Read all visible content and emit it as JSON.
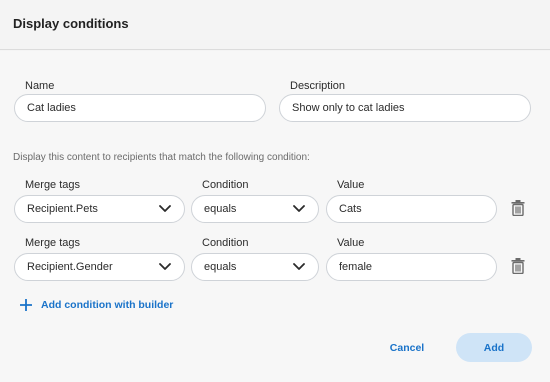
{
  "dialog": {
    "title": "Display conditions"
  },
  "form": {
    "name_label": "Name",
    "name_value": "Cat ladies",
    "description_label": "Description",
    "description_value": "Show only to cat ladies"
  },
  "helper_text": "Display this content to recipients that match the following condition:",
  "conditions": [
    {
      "merge_label": "Merge tags",
      "merge_value": "Recipient.Pets",
      "condition_label": "Condition",
      "condition_value": "equals",
      "value_label": "Value",
      "value_value": "Cats"
    },
    {
      "merge_label": "Merge tags",
      "merge_value": "Recipient.Gender",
      "condition_label": "Condition",
      "condition_value": "equals",
      "value_label": "Value",
      "value_value": "female"
    }
  ],
  "actions": {
    "add_condition_label": "Add condition with builder",
    "cancel_label": "Cancel",
    "add_label": "Add"
  },
  "colors": {
    "accent": "#1a73c9",
    "primary_button_bg": "#cfe4f7",
    "border": "#cfd3d8"
  },
  "icons": {
    "dropdown": "chevron-down-icon",
    "delete": "trash-icon",
    "add": "plus-icon"
  }
}
